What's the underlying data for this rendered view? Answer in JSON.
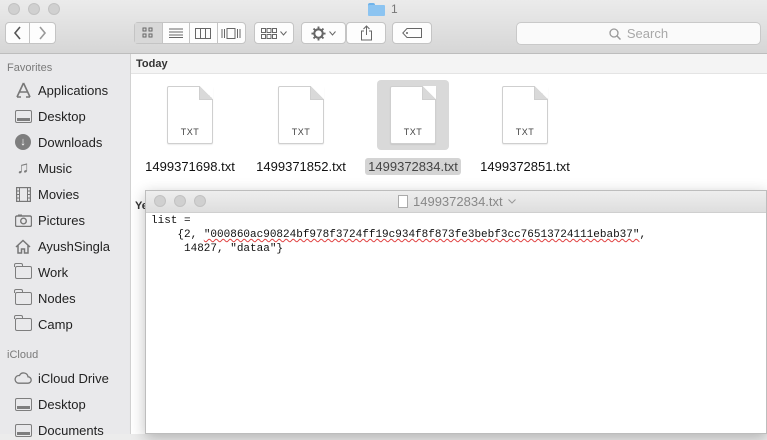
{
  "window": {
    "title": "1"
  },
  "toolbar": {
    "back_icon": "chevron-left-icon",
    "forward_icon": "chevron-right-icon",
    "view_icons": [
      "icon-view-icon",
      "list-view-icon",
      "column-view-icon",
      "cover-flow-icon"
    ],
    "arrange_icon": "arrange-grid-icon",
    "action_icon": "gear-icon",
    "share_icon": "share-icon",
    "tags_icon": "tag-icon"
  },
  "search": {
    "placeholder": "Search"
  },
  "sidebar": {
    "favorites_header": "Favorites",
    "favorites": [
      {
        "label": "Applications",
        "icon": "applications-icon"
      },
      {
        "label": "Desktop",
        "icon": "desktop-icon"
      },
      {
        "label": "Downloads",
        "icon": "downloads-icon"
      },
      {
        "label": "Music",
        "icon": "music-icon"
      },
      {
        "label": "Movies",
        "icon": "movies-icon"
      },
      {
        "label": "Pictures",
        "icon": "pictures-icon"
      },
      {
        "label": "AyushSingla",
        "icon": "home-icon"
      },
      {
        "label": "Work",
        "icon": "folder-icon"
      },
      {
        "label": "Nodes",
        "icon": "folder-icon"
      },
      {
        "label": "Camp",
        "icon": "folder-icon"
      }
    ],
    "icloud_header": "iCloud",
    "icloud": [
      {
        "label": "iCloud Drive",
        "icon": "cloud-icon"
      },
      {
        "label": "Desktop",
        "icon": "desktop-icon"
      },
      {
        "label": "Documents",
        "icon": "documents-icon"
      }
    ]
  },
  "content": {
    "section_today": "Today",
    "section_partial": "Ye",
    "files": [
      {
        "name": "1499371698.txt",
        "ext": "TXT",
        "selected": false
      },
      {
        "name": "1499371852.txt",
        "ext": "TXT",
        "selected": false
      },
      {
        "name": "1499372834.txt",
        "ext": "TXT",
        "selected": true
      },
      {
        "name": "1499372851.txt",
        "ext": "TXT",
        "selected": false
      }
    ]
  },
  "quicklook": {
    "title": "1499372834.txt",
    "line1": "list =",
    "line2_prefix": "    {2, ",
    "line2_hash": "\"000860ac90824bf978f3724ff19c934f8f873fe3bebf3cc76513724111ebab37\"",
    "line2_suffix": ",",
    "line3": "     14827, \"dataa\"}"
  }
}
